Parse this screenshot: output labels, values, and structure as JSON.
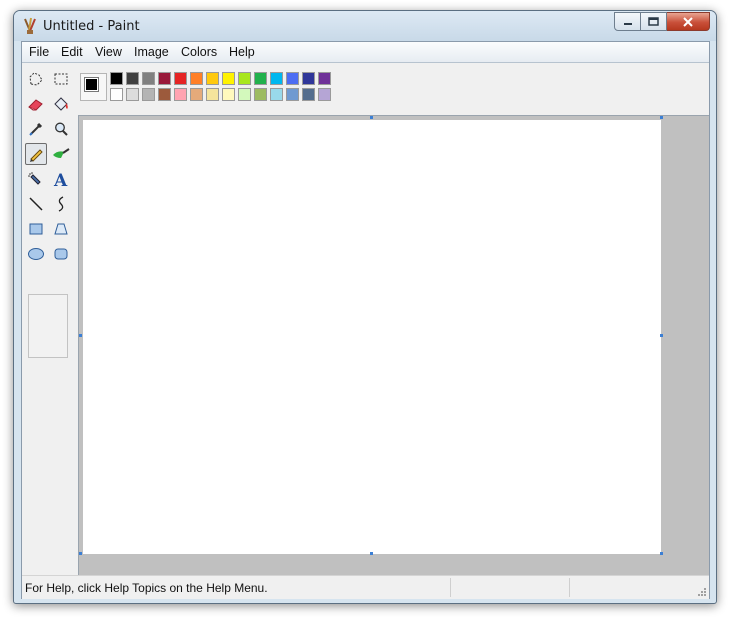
{
  "window": {
    "title": "Untitled - Paint"
  },
  "menu": {
    "items": [
      "File",
      "Edit",
      "View",
      "Image",
      "Colors",
      "Help"
    ]
  },
  "tools": [
    {
      "name": "free-form-select-icon"
    },
    {
      "name": "select-icon"
    },
    {
      "name": "eraser-icon"
    },
    {
      "name": "fill-bucket-icon"
    },
    {
      "name": "color-picker-icon"
    },
    {
      "name": "magnifier-icon"
    },
    {
      "name": "pencil-icon",
      "active": true
    },
    {
      "name": "brush-icon"
    },
    {
      "name": "airbrush-icon"
    },
    {
      "name": "text-icon",
      "glyph": "A"
    },
    {
      "name": "line-icon"
    },
    {
      "name": "curve-icon"
    },
    {
      "name": "rectangle-icon"
    },
    {
      "name": "polygon-icon"
    },
    {
      "name": "ellipse-icon"
    },
    {
      "name": "rounded-rectangle-icon"
    }
  ],
  "colors": {
    "foreground": "#000000",
    "background": "#ffffff",
    "palette_row1": [
      "#000000",
      "#404040",
      "#808080",
      "#99193a",
      "#e52424",
      "#ff7f27",
      "#ffc90e",
      "#fff200",
      "#a8e61d",
      "#22b14c",
      "#00b7ef",
      "#4d6df3",
      "#2f3699",
      "#6f3198"
    ],
    "palette_row2": [
      "#ffffff",
      "#dcdcdc",
      "#b4b4b4",
      "#9c5a3c",
      "#ffa3b1",
      "#e5aa7a",
      "#f5e49c",
      "#fff9bd",
      "#d3f9bc",
      "#9dbb61",
      "#99d9ea",
      "#709ad1",
      "#546d8e",
      "#b5a5d5"
    ]
  },
  "status": {
    "text": "For Help, click Help Topics on the Help Menu."
  }
}
